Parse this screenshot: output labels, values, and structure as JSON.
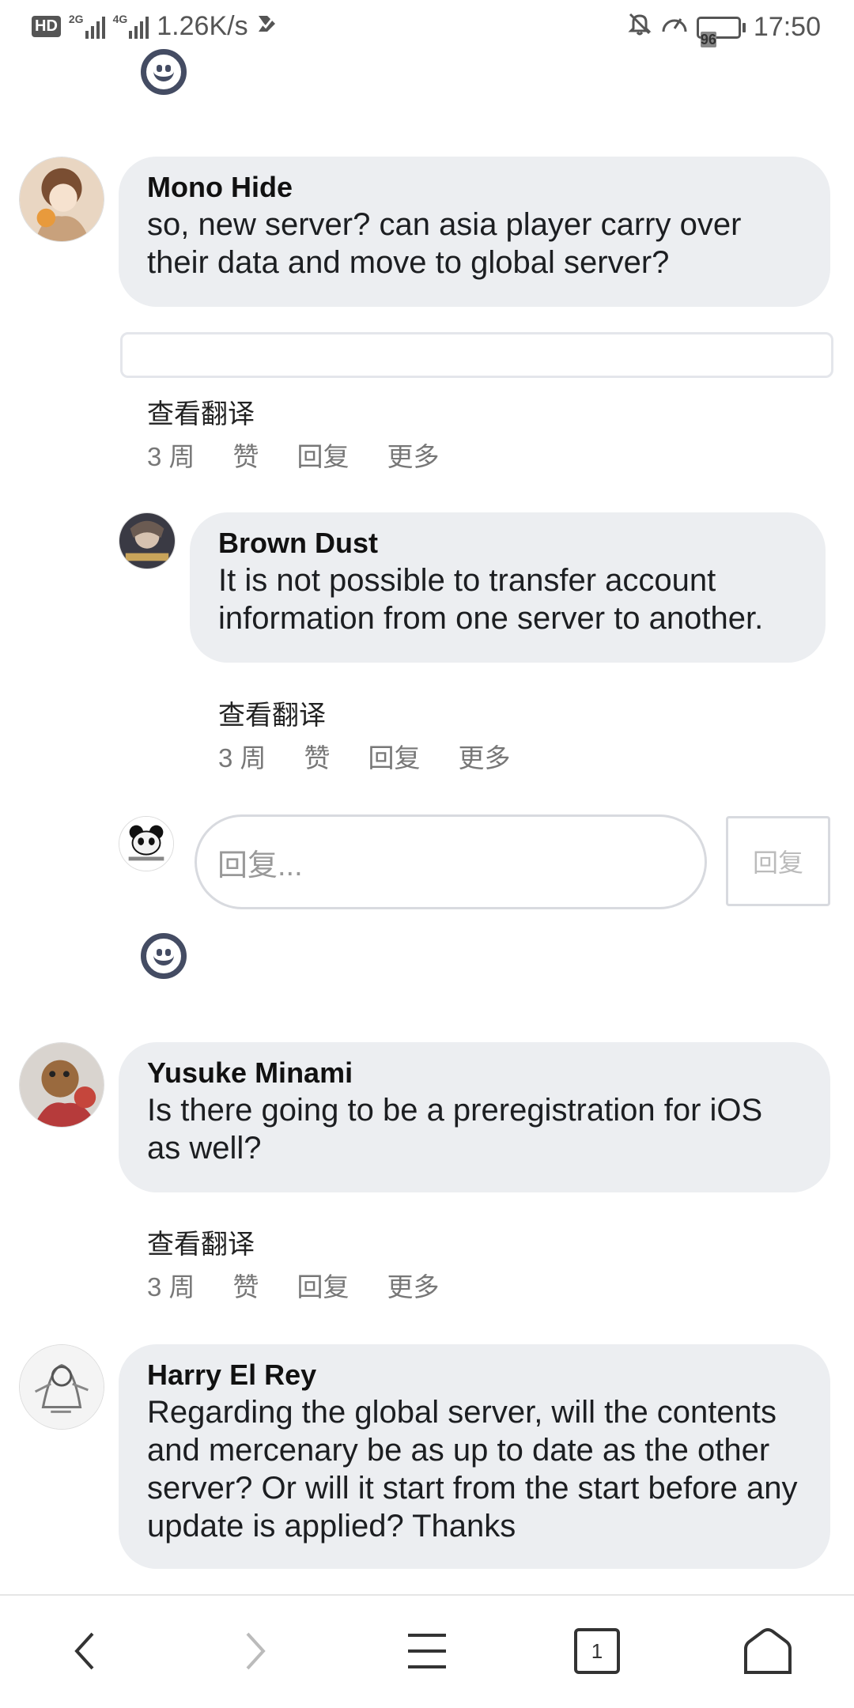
{
  "status_bar": {
    "network_speed": "1.26K/s",
    "network_2g": "2G",
    "network_4g": "4G",
    "hd_label": "HD",
    "battery": "96",
    "time": "17:50"
  },
  "comments": [
    {
      "author": "Mono Hide",
      "text": "so, new server? can asia player carry over their data and move to global server?",
      "see_translation": "查看翻译",
      "time": "3 周",
      "like": "赞",
      "reply": "回复",
      "more": "更多"
    },
    {
      "author": "Brown Dust",
      "text": "It is not possible to transfer account information from one server to another.",
      "see_translation": "查看翻译",
      "time": "3 周",
      "like": "赞",
      "reply": "回复",
      "more": "更多"
    },
    {
      "author": "Yusuke Minami",
      "text": "Is there going to be a preregistration for iOS as well?",
      "see_translation": "查看翻译",
      "time": "3 周",
      "like": "赞",
      "reply": "回复",
      "more": "更多"
    },
    {
      "author": "Harry El Rey",
      "text": "Regarding the global server, will the contents and mercenary be as up to date as the other server? Or will it start from the start before any update is applied? Thanks"
    }
  ],
  "reply_box": {
    "placeholder": "回复...",
    "button_label": "回复"
  },
  "bottom_nav": {
    "tabs_count": "1"
  },
  "colors": {
    "bubble": "#eceef1",
    "smiley": "#444c63",
    "muted_text": "#777777"
  }
}
